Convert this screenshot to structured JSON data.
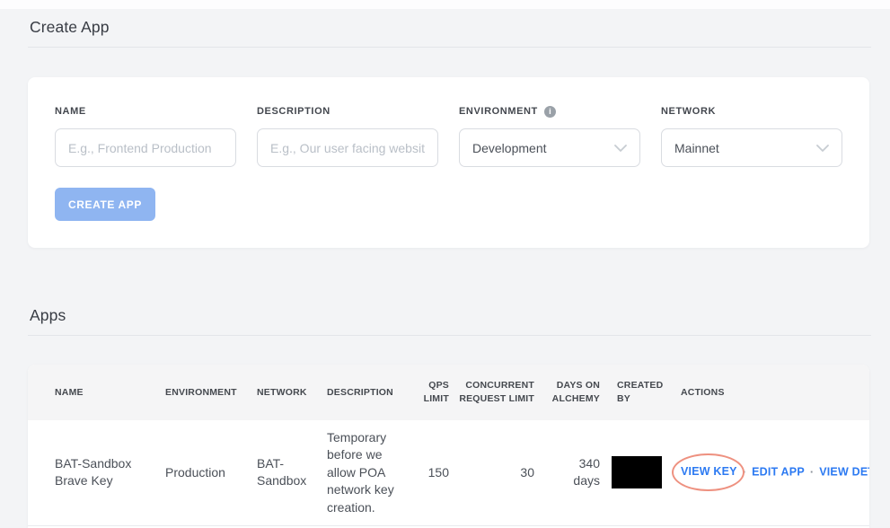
{
  "colors": {
    "page_bg": "#f3f4f6",
    "card_bg": "#ffffff",
    "primary_button_bg": "#8fb5f1",
    "primary_button_text": "#ffffff",
    "action_link": "#2c7af2",
    "highlight_ellipse": "#ee9180",
    "redaction": "#000000"
  },
  "create_app_section": {
    "title": "Create App",
    "form": {
      "name_label": "NAME",
      "name_placeholder": "E.g., Frontend Production",
      "description_label": "DESCRIPTION",
      "description_placeholder": "E.g., Our user facing website",
      "environment_label": "ENVIRONMENT",
      "environment_value": "Development",
      "network_label": "NETWORK",
      "network_value": "Mainnet",
      "submit_label": "CREATE APP",
      "info_icon_glyph": "i"
    }
  },
  "apps_section": {
    "title": "Apps",
    "table": {
      "headers": [
        "NAME",
        "ENVIRONMENT",
        "NETWORK",
        "DESCRIPTION",
        "QPS LIMIT",
        "CONCURRENT REQUEST LIMIT",
        "DAYS ON ALCHEMY",
        "CREATED BY",
        "ACTIONS"
      ],
      "rows": [
        {
          "name": "BAT-Sandbox Brave Key",
          "environment": "Production",
          "network": "BAT-Sandbox",
          "description": "Temporary before we allow POA network key creation.",
          "qps_limit": "150",
          "concurrent_request_limit": "30",
          "days_on_alchemy": "340 days",
          "actions": {
            "view_key": "VIEW KEY",
            "edit_app": "EDIT APP",
            "view_details": "VIEW DETAILS",
            "separator": "·"
          }
        }
      ]
    }
  }
}
